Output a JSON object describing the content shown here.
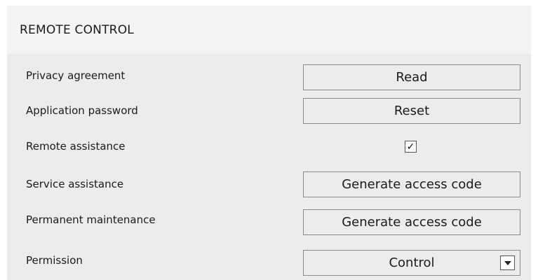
{
  "header": {
    "title": "REMOTE CONTROL"
  },
  "rows": {
    "privacy": {
      "label": "Privacy agreement",
      "button": "Read"
    },
    "app_password": {
      "label": "Application password",
      "button": "Reset"
    },
    "remote_assistance": {
      "label": "Remote assistance",
      "checked": true,
      "check_glyph": "✓"
    },
    "service_assistance": {
      "label": "Service assistance",
      "button": "Generate access code"
    },
    "permanent_maintenance": {
      "label": "Permanent maintenance",
      "button": "Generate access code"
    },
    "permission": {
      "label": "Permission",
      "selected": "Control",
      "arrow_icon": "chevron-down-icon"
    }
  }
}
